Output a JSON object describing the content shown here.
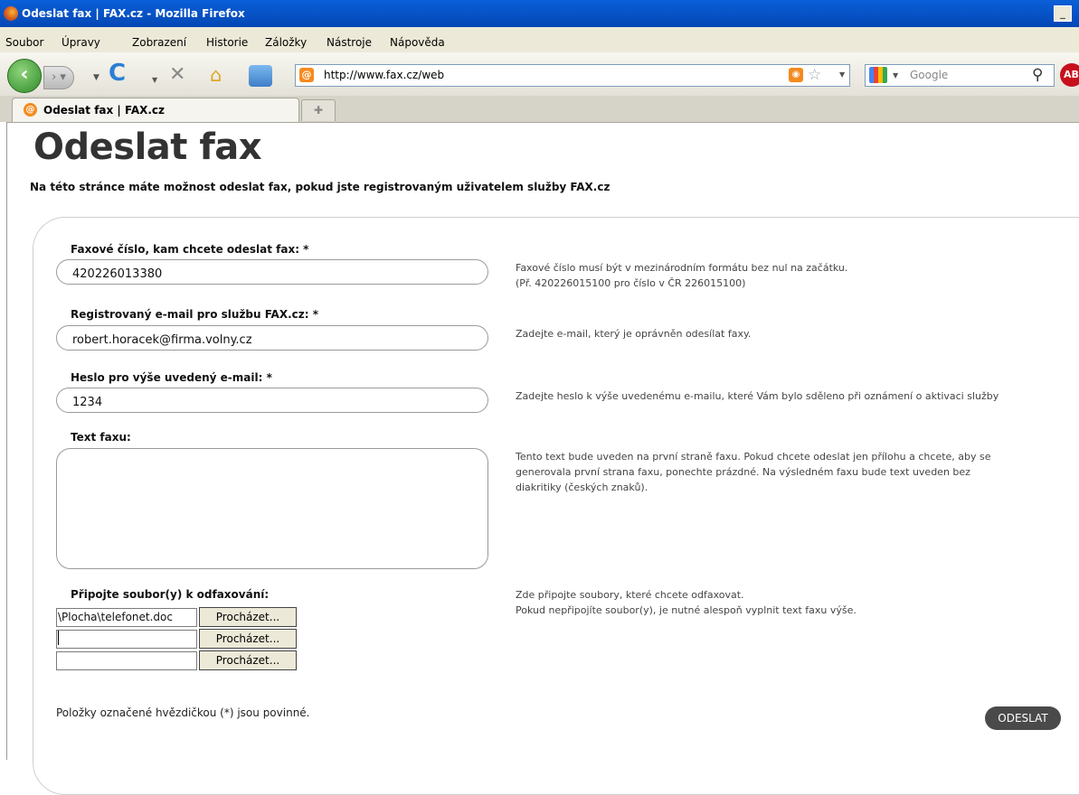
{
  "window": {
    "title": "Odeslat fax | FAX.cz - Mozilla Firefox",
    "minimize_label": "_"
  },
  "menu": [
    "Soubor",
    "Úpravy",
    "Zobrazení",
    "Historie",
    "Záložky",
    "Nástroje",
    "Nápověda"
  ],
  "toolbar": {
    "back_icon": "back-arrow-icon",
    "forward_icon": "forward-arrow-icon",
    "reload_glyph": "C",
    "stop_glyph": "✕",
    "url": "http://www.fax.cz/web",
    "search_placeholder": "Google",
    "abp_label": "AB"
  },
  "tabs": [
    {
      "label": "Odeslat fax | FAX.cz",
      "active": true
    }
  ],
  "page": {
    "title": "Odeslat fax",
    "intro": "Na této stránce máte možnost odeslat fax, pokud jste registrovaným uživatelem služby FAX.cz",
    "fields": {
      "fax_number": {
        "label": "Faxové číslo, kam chcete odeslat fax: *",
        "value": "420226013380",
        "help_1": "Faxové číslo musí být v mezinárodním formátu bez nul na začátku.",
        "help_2": "(Př. 420226015100 pro číslo v ČR 226015100)"
      },
      "email": {
        "label": "Registrovaný e-mail pro službu FAX.cz: *",
        "value": "robert.horacek@firma.volny.cz",
        "help": "Zadejte e-mail, který je oprávněn odesílat faxy."
      },
      "password": {
        "label": "Heslo pro výše uvedený e-mail: *",
        "value": "1234",
        "help": "Zadejte heslo k výše uvedenému e-mailu, které Vám bylo sděleno při oznámení o aktivaci služby"
      },
      "fax_text": {
        "label": "Text faxu:",
        "value": "",
        "help_1": "Tento text bude uveden na první straně faxu. Pokud chcete odeslat jen přílohu a chcete, aby se",
        "help_2": "generovala první strana faxu, ponechte prázdné. Na výsledném faxu bude text uveden bez",
        "help_3": "diakritiky (českých znaků)."
      },
      "attachments": {
        "label": "Připojte soubor(y) k odfaxování:",
        "files": [
          "\\Plocha\\telefonet.doc",
          "",
          ""
        ],
        "browse_label": "Procházet...",
        "help_1": "Zde připojte soubory, které chcete odfaxovat.",
        "help_2": "Pokud nepřipojíte soubor(y), je nutné alespoň vyplnit text faxu výše."
      }
    },
    "required_note": "Položky označené hvězdičkou (*) jsou povinné.",
    "submit_label": "ODESLAT"
  }
}
